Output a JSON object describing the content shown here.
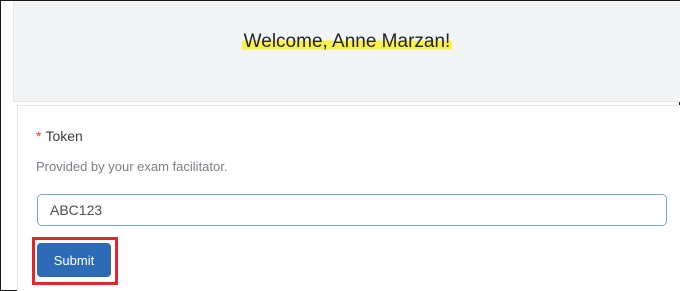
{
  "header": {
    "welcome_text": "Welcome, Anne Marzan!"
  },
  "form": {
    "required_marker": "*",
    "field_label": "Token",
    "help_text": "Provided by your exam facilitator.",
    "token_value": "ABC123",
    "submit_label": "Submit"
  },
  "colors": {
    "highlight_box": "#e2262a",
    "submit_button": "#2e6bb6",
    "welcome_highlight": "#fbf04a",
    "required_star": "#e03b3b"
  }
}
